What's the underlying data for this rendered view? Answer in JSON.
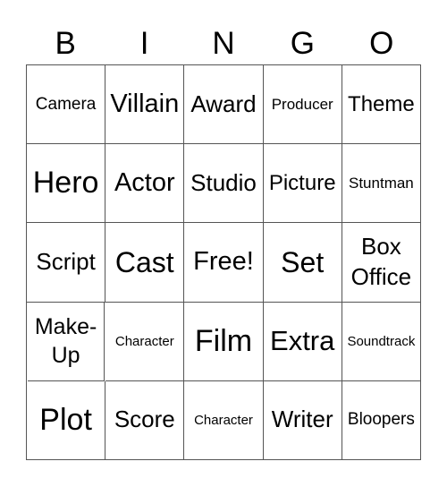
{
  "header": {
    "letters": [
      "B",
      "I",
      "N",
      "G",
      "O"
    ]
  },
  "cells": [
    [
      "Camera",
      "Villain",
      "Award",
      "Producer",
      "Theme"
    ],
    [
      "Hero",
      "Actor",
      "Studio",
      "Picture",
      "Stuntman"
    ],
    [
      "Script",
      "Cast",
      "Free!",
      "Set",
      "Box Office"
    ],
    [
      "Make-Up",
      "Character",
      "Film",
      "Extra",
      "Soundtrack"
    ],
    [
      "Plot",
      "Score",
      "Character",
      "Writer",
      "Bloopers"
    ]
  ]
}
